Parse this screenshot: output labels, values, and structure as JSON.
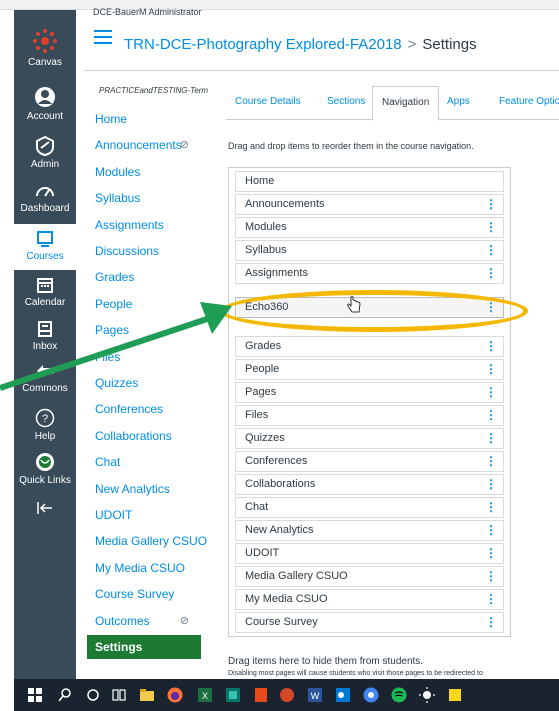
{
  "global_nav": {
    "logo": "Canvas",
    "items": [
      {
        "label": "Account",
        "icon": "account-icon"
      },
      {
        "label": "Admin",
        "icon": "admin-icon"
      },
      {
        "label": "Dashboard",
        "icon": "dashboard-icon"
      },
      {
        "label": "Courses",
        "icon": "courses-icon",
        "active": true
      },
      {
        "label": "Calendar",
        "icon": "calendar-icon"
      },
      {
        "label": "Inbox",
        "icon": "inbox-icon"
      },
      {
        "label": "Commons",
        "icon": "commons-icon"
      },
      {
        "label": "Help",
        "icon": "help-icon"
      },
      {
        "label": "Quick Links",
        "icon": "quick-links-icon"
      }
    ],
    "collapse_icon": "collapse-icon"
  },
  "header": {
    "user": "DCE-BauerM Administrator",
    "course": "TRN-DCE-Photography Explored-FA2018",
    "separator": ">",
    "current": "Settings"
  },
  "course_nav": {
    "term": "PRACTICEandTESTING-Term",
    "items": [
      {
        "label": "Home"
      },
      {
        "label": "Announcements",
        "hidden": true
      },
      {
        "label": "Modules"
      },
      {
        "label": "Syllabus"
      },
      {
        "label": "Assignments"
      },
      {
        "label": "Discussions"
      },
      {
        "label": "Grades"
      },
      {
        "label": "People"
      },
      {
        "label": "Pages"
      },
      {
        "label": "Files"
      },
      {
        "label": "Quizzes"
      },
      {
        "label": "Conferences"
      },
      {
        "label": "Collaborations"
      },
      {
        "label": "Chat"
      },
      {
        "label": "New Analytics"
      },
      {
        "label": "UDOIT"
      },
      {
        "label": "Media Gallery CSUO"
      },
      {
        "label": "My Media CSUO"
      },
      {
        "label": "Course Survey"
      },
      {
        "label": "Outcomes",
        "hidden": true
      },
      {
        "label": "Settings",
        "active": true
      }
    ]
  },
  "tabs": [
    "Course Details",
    "Sections",
    "Navigation",
    "Apps",
    "Feature Options"
  ],
  "active_tab": "Navigation",
  "instruction": "Drag and drop items to reorder them in the course navigation.",
  "nav_list": [
    "Home",
    "Announcements",
    "Modules",
    "Syllabus",
    "Assignments",
    "Echo360",
    "Grades",
    "People",
    "Pages",
    "Files",
    "Quizzes",
    "Conferences",
    "Collaborations",
    "Chat",
    "New Analytics",
    "UDOIT",
    "Media Gallery CSUO",
    "My Media CSUO",
    "Course Survey"
  ],
  "dragging_item": "Echo360",
  "hidden_section": {
    "title": "Drag items here to hide them from students.",
    "subtitle": "Disabling most pages will cause students who visit those pages to be redirected to"
  },
  "colors": {
    "global_nav_bg": "#394b58",
    "link": "#008ee2",
    "active_green": "#1c7a32",
    "highlight_ring": "#f5b800",
    "arrow": "#1f9d55"
  }
}
